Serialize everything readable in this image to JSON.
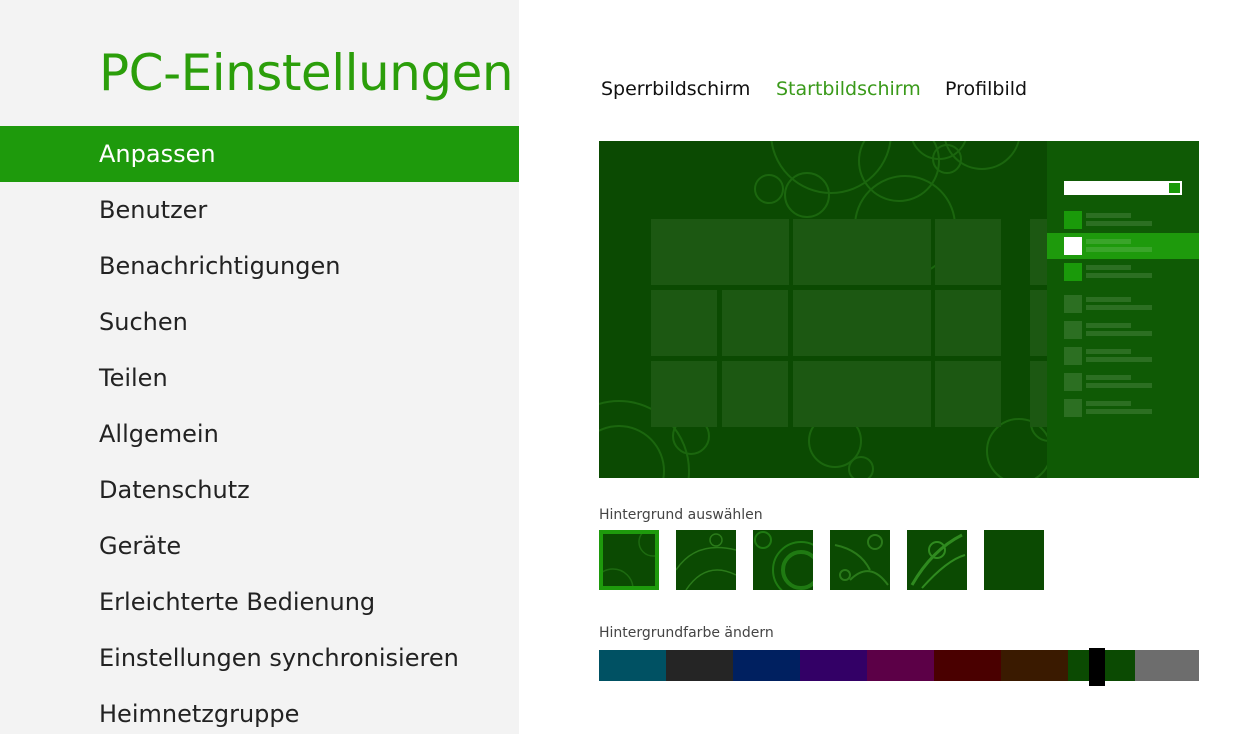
{
  "sidebar": {
    "title": "PC-Einstellungen",
    "items": [
      {
        "label": "Anpassen",
        "selected": true
      },
      {
        "label": "Benutzer"
      },
      {
        "label": "Benachrichtigungen"
      },
      {
        "label": "Suchen"
      },
      {
        "label": "Teilen"
      },
      {
        "label": "Allgemein"
      },
      {
        "label": "Datenschutz"
      },
      {
        "label": "Geräte"
      },
      {
        "label": "Erleichterte Bedienung"
      },
      {
        "label": "Einstellungen synchronisieren"
      },
      {
        "label": "Heimnetzgruppe"
      }
    ]
  },
  "tabs": [
    {
      "label": "Sperrbildschirm"
    },
    {
      "label": "Startbildschirm",
      "active": true
    },
    {
      "label": "Profilbild"
    }
  ],
  "background": {
    "label": "Hintergrund auswählen",
    "selected_index": 0,
    "count": 6
  },
  "color": {
    "label": "Hintergrundfarbe ändern",
    "swatches": [
      "#005163",
      "#252525",
      "#002060",
      "#330066",
      "#5c0047",
      "#4a0000",
      "#3a1a00",
      "#0b4a02",
      "#6d6d6d"
    ],
    "selected_index": 7,
    "accent": "#1e9a0c"
  }
}
